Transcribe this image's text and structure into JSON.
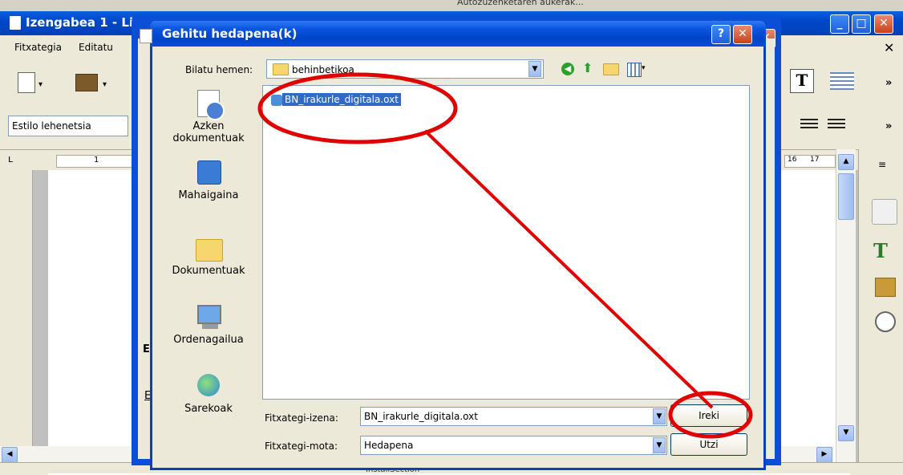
{
  "background_window": {
    "title": "Izengabea 1 - Lib",
    "top_strip_text": "Autozuzenketaren aukerak...",
    "menu": [
      "Fitxategia",
      "Editatu"
    ],
    "style_box": "Estilo lehenetsia",
    "ruler_left_tick": "1",
    "ruler_right_ticks": [
      "16",
      "17"
    ],
    "page_fragments": [
      "E",
      "E",
      "b"
    ],
    "bottom_fragment": "InstallSection"
  },
  "dialog": {
    "title": "Gehitu hedapena(k)",
    "lookin_label": "Bilatu hemen:",
    "lookin_value": "behinbetikoa",
    "places": [
      {
        "label": "Azken dokumentuak",
        "icon": "recent-documents-icon"
      },
      {
        "label": "Mahaigaina",
        "icon": "desktop-icon"
      },
      {
        "label": "Dokumentuak",
        "icon": "my-documents-icon"
      },
      {
        "label": "Ordenagailua",
        "icon": "my-computer-icon"
      },
      {
        "label": "Sarekoak",
        "icon": "network-icon"
      }
    ],
    "files": [
      "BN_irakurle_digitala.oxt"
    ],
    "filename_label": "Fitxategi-izena:",
    "filename_value": "BN_irakurle_digitala.oxt",
    "filetype_label": "Fitxategi-mota:",
    "filetype_value": "Hedapena",
    "open_button": "Ireki",
    "cancel_button": "Utzi"
  },
  "colors": {
    "xp_title_blue": "#0a4fd6",
    "annotation_red": "#e00000",
    "selection_blue": "#316ac5"
  }
}
